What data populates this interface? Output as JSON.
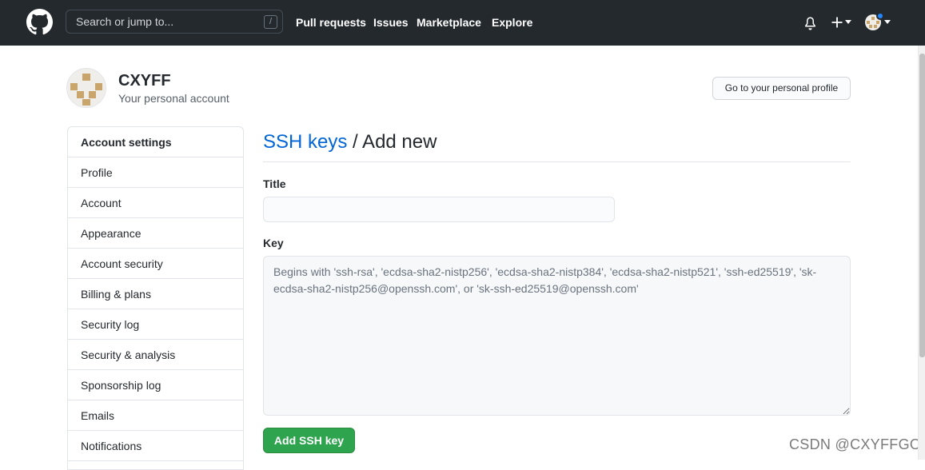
{
  "header": {
    "search_placeholder": "Search or jump to...",
    "search_shortcut": "/",
    "nav": [
      "Pull requests",
      "Issues",
      "Marketplace",
      "Explore"
    ]
  },
  "account": {
    "name": "CXYFF",
    "subtitle": "Your personal account",
    "profile_button": "Go to your personal profile"
  },
  "sidebar": {
    "heading": "Account settings",
    "items": [
      "Profile",
      "Account",
      "Appearance",
      "Account security",
      "Billing & plans",
      "Security log",
      "Security & analysis",
      "Sponsorship log",
      "Emails",
      "Notifications"
    ]
  },
  "main": {
    "breadcrumb_link": "SSH keys",
    "breadcrumb_rest": " / Add new",
    "title_label": "Title",
    "title_value": "",
    "key_label": "Key",
    "key_placeholder": "Begins with 'ssh-rsa', 'ecdsa-sha2-nistp256', 'ecdsa-sha2-nistp384', 'ecdsa-sha2-nistp521', 'ssh-ed25519', 'sk-ecdsa-sha2-nistp256@openssh.com', or 'sk-ssh-ed25519@openssh.com'",
    "submit_button": "Add SSH key"
  },
  "watermark": "CSDN @CXYFFGO",
  "colors": {
    "header_bg": "#24292e",
    "link": "#0366d6",
    "primary_button": "#2ea44f",
    "notification_dot": "#2188ff"
  },
  "icons": [
    "github-mark-icon",
    "bell-icon",
    "plus-icon",
    "caret-down-icon",
    "avatar"
  ]
}
